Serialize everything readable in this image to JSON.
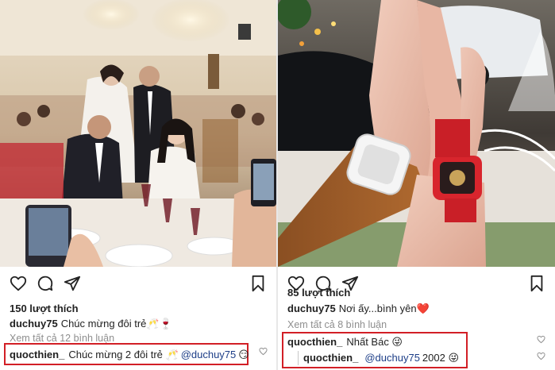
{
  "posts": [
    {
      "likes": "150 lượt thích",
      "caption_user": "duchuy75",
      "caption_text": "Chúc mừng đôi trẻ🥂🍷",
      "view_all": "Xem tất cả 12 bình luận",
      "comment": {
        "user": "quocthien_",
        "text_before": "Chúc mừng 2 đôi trẻ 🥂",
        "mention": "@duchuy75",
        "text_after": "😏"
      }
    },
    {
      "likes": "85 lượt thích",
      "caption_user": "duchuy75",
      "caption_text": "Nơi ấy...bình  yên❤️",
      "view_all": "Xem tất cả 8 bình luận",
      "comment": {
        "user": "quocthien_",
        "text": "Nhất Bác 😜"
      },
      "reply": {
        "user": "quocthien_",
        "mention": "@duchuy75",
        "text_after": "2002 😜"
      }
    }
  ],
  "icons": [
    "heart-icon",
    "comment-icon",
    "share-icon",
    "bookmark-icon"
  ],
  "colors": {
    "highlight_border": "#d21f26",
    "mention": "#1c3d87",
    "muted": "#8e8e8e"
  }
}
